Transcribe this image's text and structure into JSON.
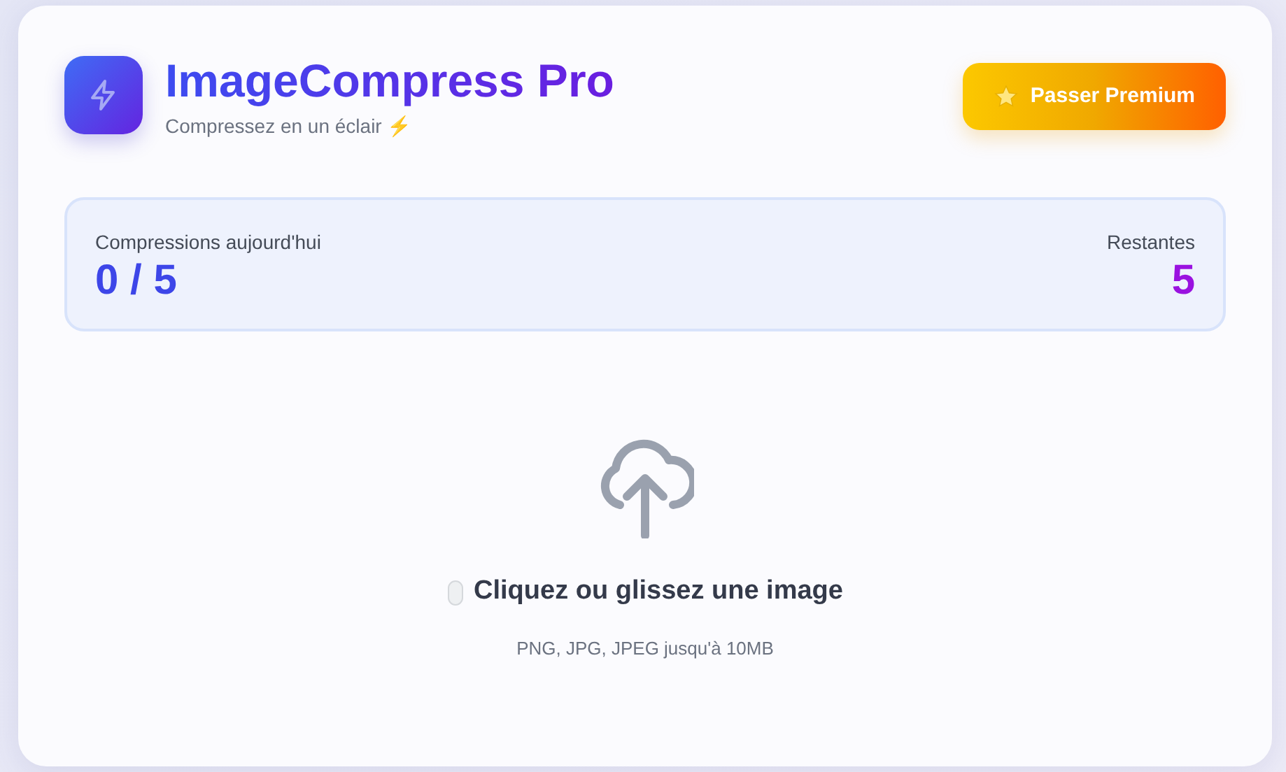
{
  "header": {
    "title": "ImageCompress Pro",
    "subtitle": "Compressez en un éclair ⚡",
    "premium_button": "Passer Premium"
  },
  "usage": {
    "label": "Compressions aujourd'hui",
    "count": "0 / 5",
    "remaining_label": "Restantes",
    "remaining": "5"
  },
  "upload": {
    "title": "Cliquez ou glissez une image",
    "hint": "PNG, JPG, JPEG jusqu'à 10MB"
  }
}
